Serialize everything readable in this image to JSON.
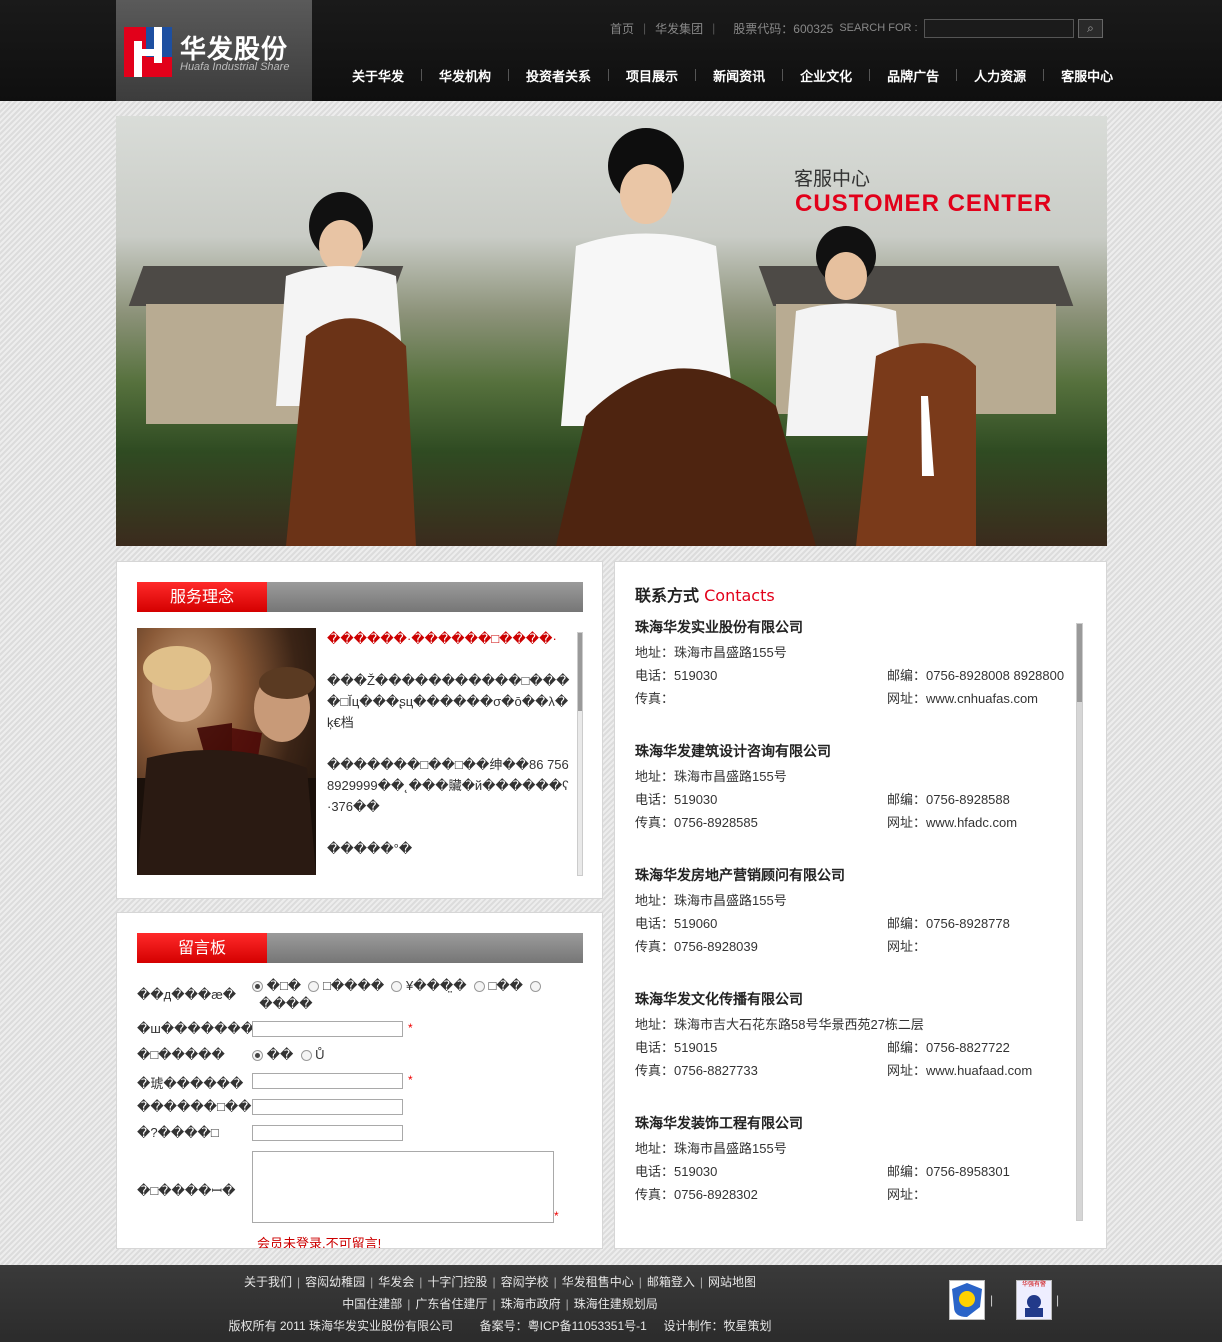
{
  "header": {
    "logo_cn": "华发股份",
    "logo_en": "Huafa Industrial Share",
    "top_links": [
      "首页",
      "华发集团"
    ],
    "stock_code": "股票代码：600325",
    "search_label": "SEARCH FOR :",
    "nav": [
      "关于华发",
      "华发机构",
      "投资者关系",
      "项目展示",
      "新闻资讯",
      "企业文化",
      "品牌广告",
      "人力资源",
      "客服中心"
    ]
  },
  "banner": {
    "title_cn": "客服中心",
    "title_en": "CUSTOMER CENTER"
  },
  "service": {
    "heading": "服务理念",
    "paragraphs": [
      "������·������□����·",
      "���Ž�����������□����□Ĭц���ʂц������σ�ō��λ�ķ€档",
      "�������□��□��绅��86 756 8929999��˛���贜�й������ʕ·376��",
      "�����°�"
    ]
  },
  "guestbook": {
    "heading": "留言板",
    "type_label": "��д���æ�",
    "type_options": [
      "�□�",
      "□����",
      "¥���̤�",
      "□��",
      "����"
    ],
    "name_label": "�ш�������",
    "gender_label": "�□�����",
    "gender_options": [
      "��",
      "Ů"
    ],
    "phone_label": "�琥������",
    "email_label": "������□��",
    "address_label": "�?����□",
    "message_label": "�□����ꟷ�",
    "required_mark": "*",
    "login_notice": "会员未登录,不可留言!"
  },
  "contacts": {
    "title_cn": "联系方式",
    "title_en": "Contacts",
    "address_label": "地址：",
    "phone_label": "电话：",
    "fax_label": "传真：",
    "postcode_label": "邮编：",
    "web_label": "网址：",
    "companies": [
      {
        "name": "珠海华发实业股份有限公司",
        "address": "珠海市昌盛路155号",
        "phone": "519030",
        "fax": "",
        "postcode": "0756-8928008 8928800",
        "web": "www.cnhuafas.com"
      },
      {
        "name": "珠海华发建筑设计咨询有限公司",
        "address": "珠海市昌盛路155号",
        "phone": "519030",
        "fax": "0756-8928585",
        "postcode": "0756-8928588",
        "web": "www.hfadc.com"
      },
      {
        "name": "珠海华发房地产营销顾问有限公司",
        "address": "珠海市昌盛路155号",
        "phone": "519060",
        "fax": "0756-8928039",
        "postcode": "0756-8928778",
        "web": ""
      },
      {
        "name": "珠海华发文化传播有限公司",
        "address": "珠海市吉大石花东路58号华景西苑27栋二层",
        "phone": "519015",
        "fax": "0756-8827733",
        "postcode": "0756-8827722",
        "web": "www.huafaad.com"
      },
      {
        "name": "珠海华发装饰工程有限公司",
        "address": "珠海市昌盛路155号",
        "phone": "519030",
        "fax": "0756-8928302",
        "postcode": "0756-8958301",
        "web": ""
      }
    ]
  },
  "footer": {
    "row1": [
      "关于我们",
      "容闳幼稚园",
      "华发会",
      "十字门控股",
      "容闳学校",
      "华发租售中心",
      "邮箱登入",
      "网站地图"
    ],
    "row2": [
      "中国住建部",
      "广东省住建厅",
      "珠海市政府",
      "珠海住建规划局"
    ],
    "copyright": "版权所有 2011 珠海华发实业股份有限公司",
    "icp": "备案号：粤ICP备11053351号-1",
    "credit": "设计制作：牧星策划",
    "badge_caption": "华强有警"
  },
  "colors": {
    "accent_red": "#e2001a",
    "header_bg": "#141414"
  }
}
